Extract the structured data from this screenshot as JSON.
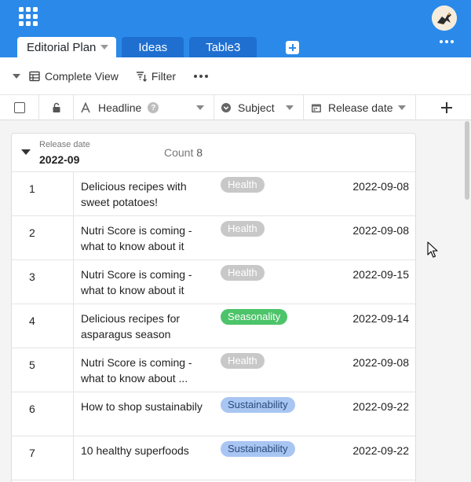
{
  "header": {
    "tabs": [
      {
        "label": "Editorial Plan",
        "active": true
      },
      {
        "label": "Ideas",
        "active": false
      },
      {
        "label": "Table3",
        "active": false
      }
    ],
    "brand_color": "#2b8ae9"
  },
  "toolbar": {
    "view_label": "Complete View",
    "filter_label": "Filter"
  },
  "columns": {
    "headline": "Headline",
    "subject": "Subject",
    "release_date": "Release date"
  },
  "group": {
    "label": "Release date",
    "value": "2022-09",
    "count_label": "Count",
    "count": "8"
  },
  "rows": [
    {
      "num": "1",
      "line1": "Delicious recipes with",
      "line2": "sweet potatoes!",
      "tag": "Health",
      "tag_color": "#c8c8c8",
      "tag_text": "#ffffff",
      "date": "2022-09-08"
    },
    {
      "num": "2",
      "line1": "Nutri Score is coming -",
      "line2": "what to know about it",
      "tag": "Health",
      "tag_color": "#c8c8c8",
      "tag_text": "#ffffff",
      "date": "2022-09-08"
    },
    {
      "num": "3",
      "line1": "Nutri Score is coming -",
      "line2": "what to know about it",
      "tag": "Health",
      "tag_color": "#c8c8c8",
      "tag_text": "#ffffff",
      "date": "2022-09-15"
    },
    {
      "num": "4",
      "line1": "Delicious recipes for",
      "line2": "asparagus season",
      "tag": "Seasonality",
      "tag_color": "#4dc46a",
      "tag_text": "#ffffff",
      "date": "2022-09-14"
    },
    {
      "num": "5",
      "line1": "Nutri Score is coming -",
      "line2": "what to know about ...",
      "tag": "Health",
      "tag_color": "#c8c8c8",
      "tag_text": "#ffffff",
      "date": "2022-09-08"
    },
    {
      "num": "6",
      "line1": "How to shop sustainabily",
      "line2": "",
      "tag": "Sustainability",
      "tag_color": "#a9c6f2",
      "tag_text": "#2a4a7a",
      "date": "2022-09-22"
    },
    {
      "num": "7",
      "line1": "10 healthy superfoods",
      "line2": "",
      "tag": "Sustainability",
      "tag_color": "#a9c6f2",
      "tag_text": "#2a4a7a",
      "date": "2022-09-22"
    }
  ]
}
